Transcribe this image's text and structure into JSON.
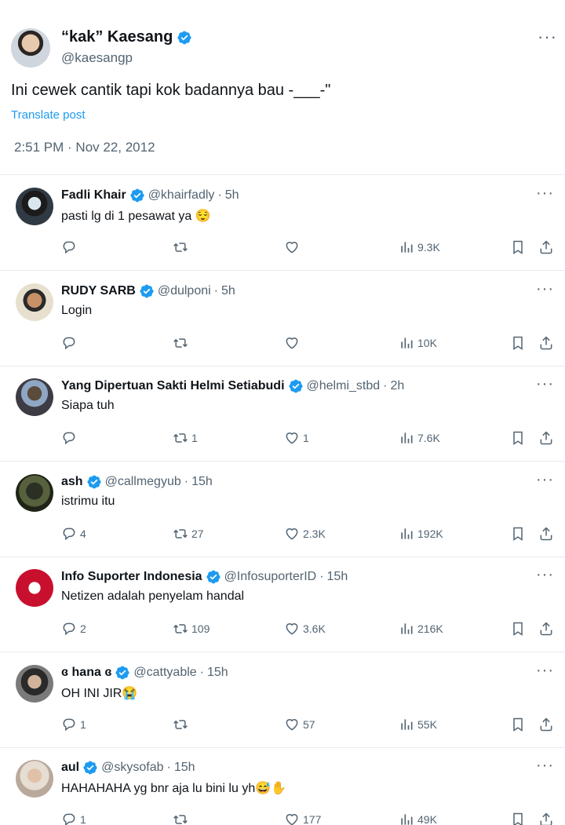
{
  "main_post": {
    "display_name": "“kak” Kaesang",
    "handle": "@kaesangp",
    "text": "Ini cewek cantik tapi kok badannya bau -___-\"",
    "translate_label": "Translate post",
    "timestamp": "2:51 PM · Nov 22, 2012",
    "more_label": "···"
  },
  "colors": {
    "accent": "#1d9bf0",
    "secondary_text": "#536471",
    "divider": "#e6ecf0"
  },
  "replies": [
    {
      "name": "Fadli Khair",
      "handle": "@khairfadly",
      "time": "5h",
      "text": "pasti lg di 1 pesawat ya 😌",
      "reply_count": "",
      "retweet_count": "",
      "like_count": "",
      "view_count": "9.3K"
    },
    {
      "name": "RUDY SARB",
      "handle": "@dulponi",
      "time": "5h",
      "text": "Login",
      "reply_count": "",
      "retweet_count": "",
      "like_count": "",
      "view_count": "10K"
    },
    {
      "name": "Yang Dipertuan Sakti Helmi Setiabudi",
      "handle": "@helmi_stbd",
      "time": "2h",
      "text": "Siapa tuh",
      "reply_count": "",
      "retweet_count": "1",
      "like_count": "1",
      "view_count": "7.6K"
    },
    {
      "name": "ash",
      "handle": "@callmegyub",
      "time": "15h",
      "text": "istrimu itu",
      "reply_count": "4",
      "retweet_count": "27",
      "like_count": "2.3K",
      "view_count": "192K"
    },
    {
      "name": "Info Suporter Indonesia",
      "handle": "@InfosuporterID",
      "time": "15h",
      "text": "Netizen adalah penyelam handal",
      "reply_count": "2",
      "retweet_count": "109",
      "like_count": "3.6K",
      "view_count": "216K"
    },
    {
      "name": "ɞ hana ɞ",
      "handle": "@cattyable",
      "time": "15h",
      "text": "OH INI JIR😭",
      "reply_count": "1",
      "retweet_count": "",
      "like_count": "57",
      "view_count": "55K"
    },
    {
      "name": "aul",
      "handle": "@skysofab",
      "time": "15h",
      "text": "HAHAHAHA yg bnr aja lu bini lu yh😅✋",
      "reply_count": "1",
      "retweet_count": "",
      "like_count": "177",
      "view_count": "49K"
    }
  ],
  "separator": "·",
  "icons": [
    "verified-badge-icon",
    "reply-icon",
    "retweet-icon",
    "like-icon",
    "views-icon",
    "bookmark-icon",
    "share-icon",
    "more-icon"
  ]
}
